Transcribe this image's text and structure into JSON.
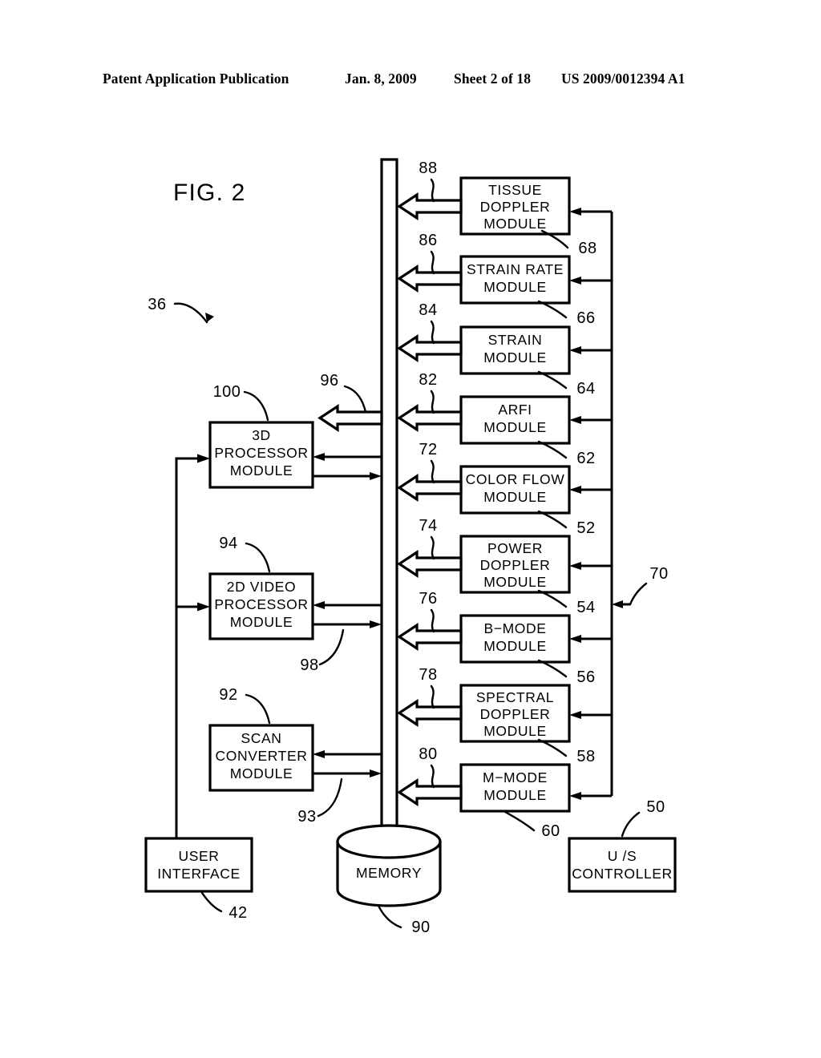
{
  "header": {
    "publication": "Patent Application Publication",
    "date": "Jan. 8, 2009",
    "sheet": "Sheet 2 of 18",
    "number": "US 2009/0012394 A1"
  },
  "figure": {
    "title": "FIG. 2",
    "system_ref": "36"
  },
  "modules": {
    "right_column": [
      {
        "id": "tissue-doppler",
        "lines": [
          "TISSUE",
          "DOPPLER",
          "MODULE"
        ],
        "ref": "68",
        "bus_arrow_ref": "88"
      },
      {
        "id": "strain-rate",
        "lines": [
          "STRAIN  RATE",
          "MODULE"
        ],
        "ref": "66",
        "bus_arrow_ref": "86"
      },
      {
        "id": "strain",
        "lines": [
          "STRAIN",
          "MODULE"
        ],
        "ref": "64",
        "bus_arrow_ref": "84"
      },
      {
        "id": "arfi",
        "lines": [
          "ARFI",
          "MODULE"
        ],
        "ref": "62",
        "bus_arrow_ref": "82"
      },
      {
        "id": "color-flow",
        "lines": [
          "COLOR  FLOW",
          "MODULE"
        ],
        "ref": "52",
        "bus_arrow_ref": "72"
      },
      {
        "id": "power-doppler",
        "lines": [
          "POWER",
          "DOPPLER",
          "MODULE"
        ],
        "ref": "54",
        "bus_arrow_ref": "74"
      },
      {
        "id": "b-mode",
        "lines": [
          "B−MODE",
          "MODULE"
        ],
        "ref": "56",
        "bus_arrow_ref": "76"
      },
      {
        "id": "spectral-doppler",
        "lines": [
          "SPECTRAL",
          "DOPPLER",
          "MODULE"
        ],
        "ref": "58",
        "bus_arrow_ref": "78"
      },
      {
        "id": "m-mode",
        "lines": [
          "M−MODE",
          "MODULE"
        ],
        "ref": "60",
        "bus_arrow_ref": "80"
      }
    ],
    "left_column": [
      {
        "id": "3d-processor",
        "lines": [
          "3D",
          "PROCESSOR",
          "MODULE"
        ],
        "ref": "100",
        "bus_arrow_ref": "96"
      },
      {
        "id": "2d-video-processor",
        "lines": [
          "2D  VIDEO",
          "PROCESSOR",
          "MODULE"
        ],
        "ref": "94",
        "bus_arrow_ref": "98"
      },
      {
        "id": "scan-converter",
        "lines": [
          "SCAN",
          "CONVERTER",
          "MODULE"
        ],
        "ref": "92",
        "bus_arrow_ref": "93"
      }
    ],
    "user_interface": {
      "id": "user-interface",
      "lines": [
        "USER",
        "INTERFACE"
      ],
      "ref": "42"
    },
    "memory": {
      "id": "memory",
      "label": "MEMORY",
      "ref": "90"
    },
    "us_controller": {
      "id": "us-controller",
      "lines": [
        "U /S",
        "CONTROLLER"
      ],
      "ref": "50"
    }
  },
  "buses": {
    "control_bus_ref": "70"
  },
  "colors": {
    "ink": "#000000",
    "paper": "#ffffff"
  }
}
